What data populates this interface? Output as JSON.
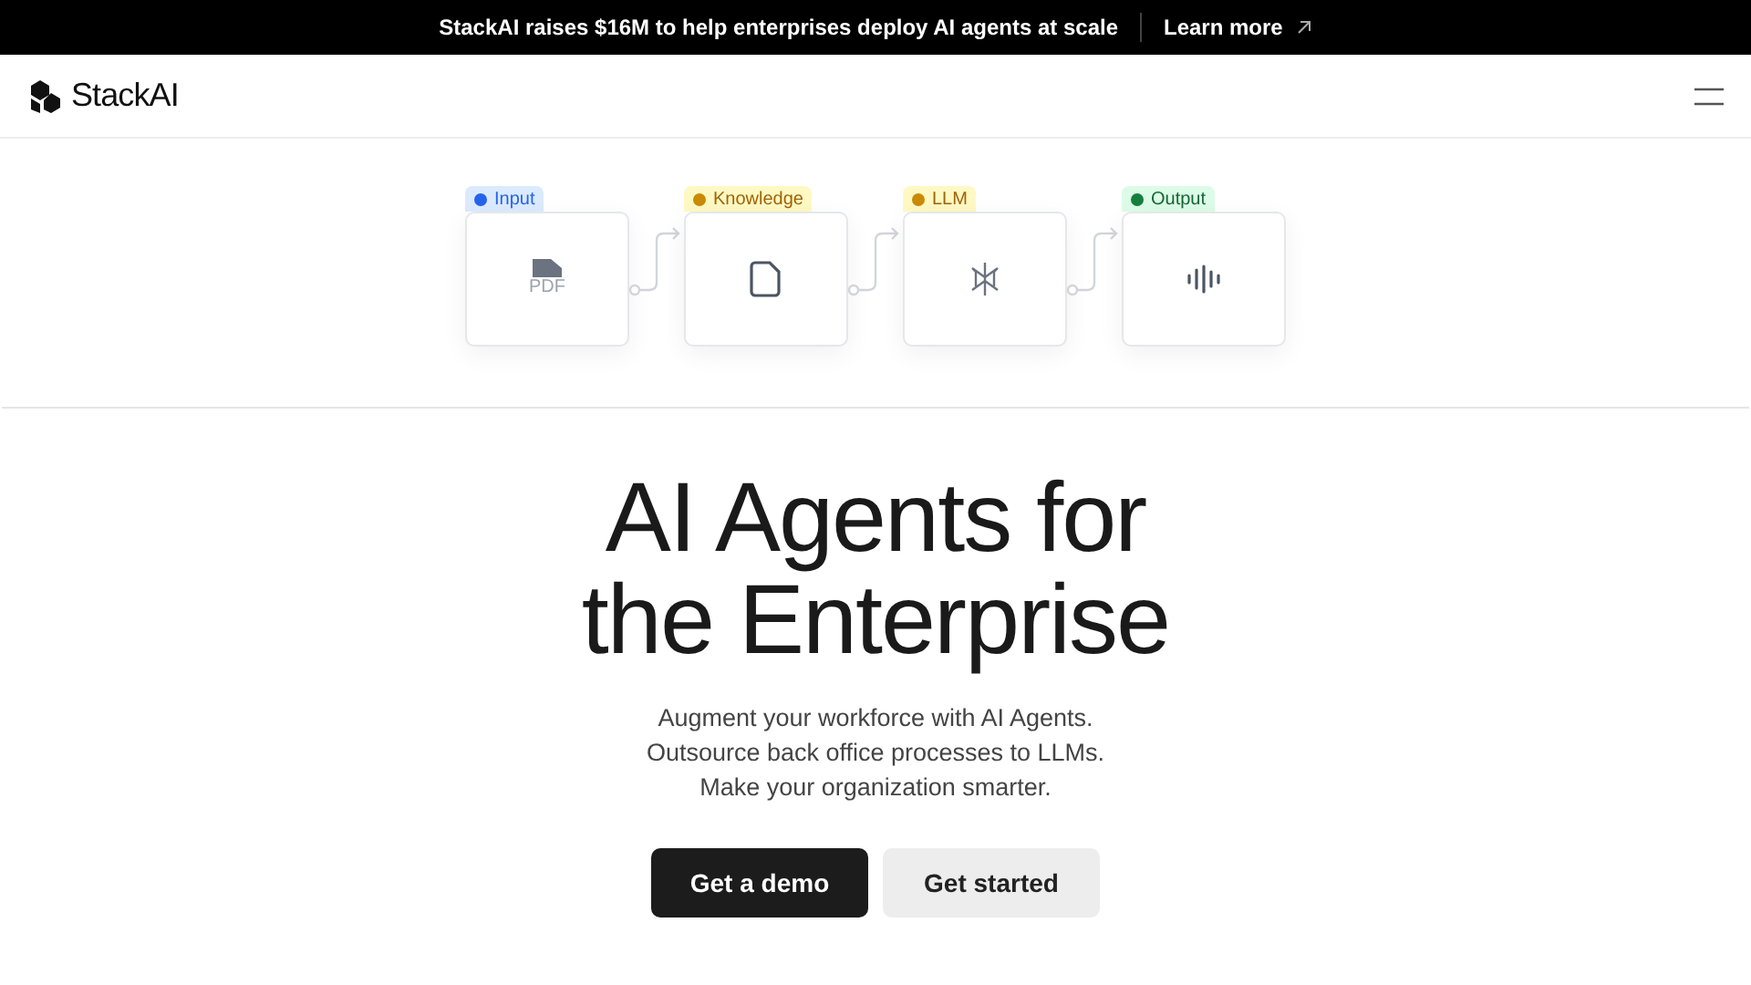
{
  "announcement": {
    "text": "StackAI raises $16M to help enterprises deploy AI agents at scale",
    "link": "Learn more"
  },
  "nav": {
    "logo": "StackAI"
  },
  "workflow": [
    {
      "label": "Input",
      "color": "#2563eb",
      "kind": "pdf",
      "icon_text": "PDF"
    },
    {
      "label": "Knowledge",
      "color": "#ca8a04",
      "kind": "document"
    },
    {
      "label": "LLM",
      "color": "#ca8a04",
      "kind": "llm"
    },
    {
      "label": "Output",
      "color": "#15803d",
      "kind": "audio"
    }
  ],
  "hero": {
    "title_lines": [
      "AI Agents for",
      "the Enterprise"
    ],
    "subtitle_lines": [
      "Augment your workforce with AI Agents.",
      "Outsource back office processes to LLMs.",
      "Make your organization smarter."
    ],
    "buttons": [
      {
        "label": "Get a demo",
        "kind": "primary"
      },
      {
        "label": "Get started",
        "kind": "secondary"
      }
    ]
  }
}
